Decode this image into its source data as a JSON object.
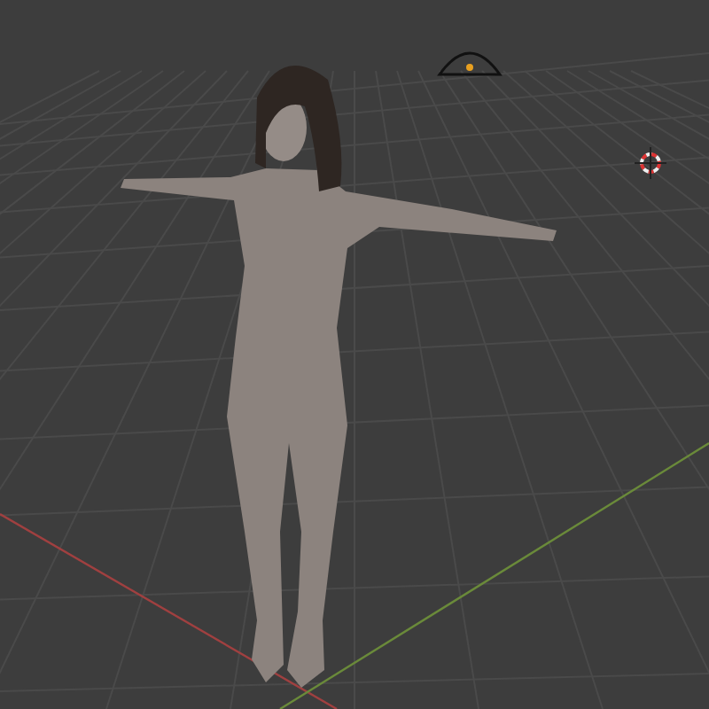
{
  "viewport": {
    "objects": [
      {
        "kind": "figure"
      },
      {
        "kind": "light"
      },
      {
        "kind": "cursor"
      }
    ]
  }
}
